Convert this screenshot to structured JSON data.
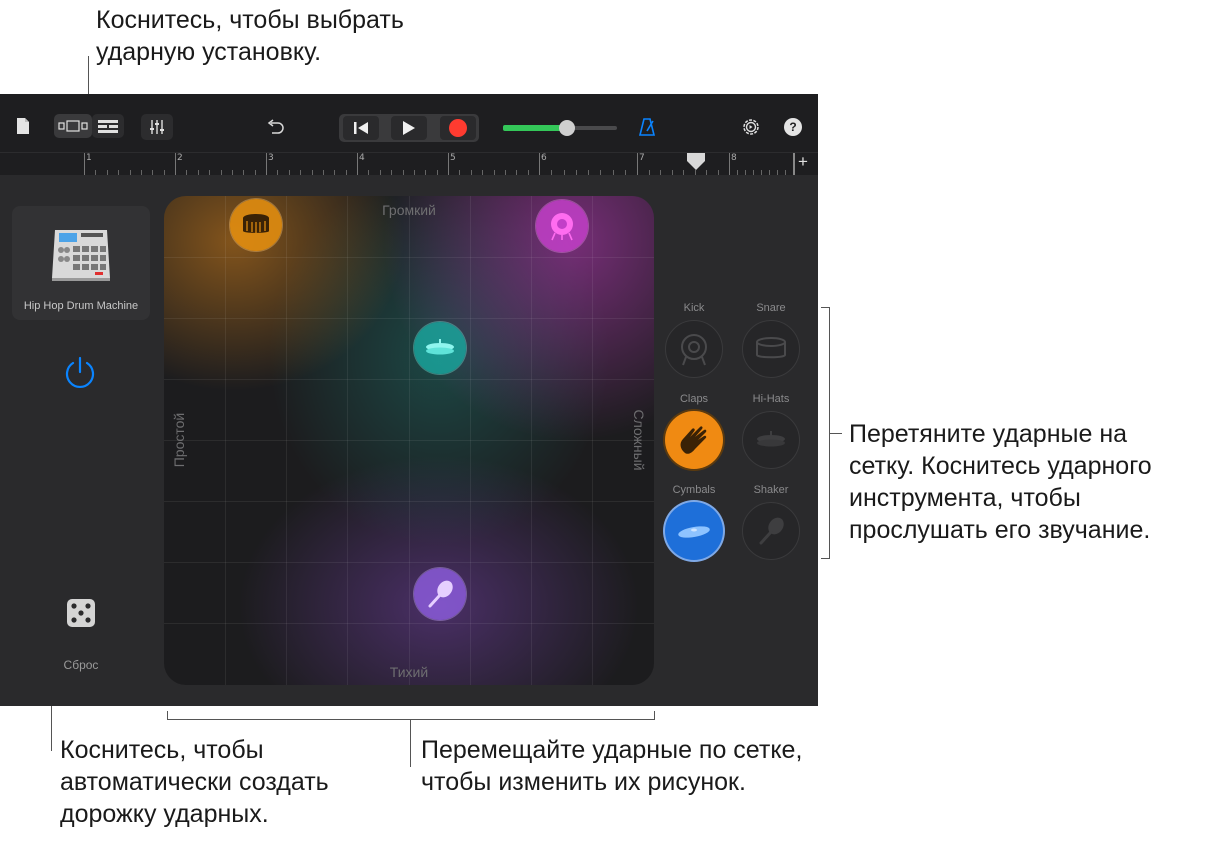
{
  "callouts": {
    "top_line1": "Коснитесь, чтобы выбрать",
    "top_line2": "ударную установку.",
    "right_line1": "Перетяните ударные на",
    "right_line2": "сетку. Коснитесь ударного",
    "right_line3": "инструмента, чтобы",
    "right_line4": "прослушать его звучание.",
    "bl_line1": "Коснитесь, чтобы",
    "bl_line2": "автоматически создать",
    "bl_line3": "дорожку ударных.",
    "bm_line1": "Перемещайте ударные по сетке,",
    "bm_line2": "чтобы изменить их рисунок."
  },
  "toolbar": {
    "icons": [
      "document-icon",
      "view-toggle-icon",
      "tracks-view-icon",
      "mixer-icon",
      "undo-icon",
      "go-to-start-icon",
      "play-icon",
      "record-icon",
      "volume-slider",
      "metronome-icon",
      "settings-icon",
      "help-icon"
    ],
    "help_label": "?",
    "volume_level": 0.8,
    "colors": {
      "record": "#ff3b30",
      "volume": "#34c759",
      "metronome": "#0a84ff"
    }
  },
  "ruler": {
    "bars": [
      "1",
      "2",
      "3",
      "4",
      "5",
      "6",
      "7",
      "8"
    ],
    "add_label": "+"
  },
  "left_panel": {
    "kit_name": "Hip Hop Drum Machine",
    "kit_icon": "drum-machine-icon",
    "power_icon": "power-icon",
    "dice_icon": "dice-icon",
    "reset_label": "Сброс",
    "power_color": "#0a84ff"
  },
  "grid": {
    "loud_label": "Громкий",
    "quiet_label": "Тихий",
    "simple_label": "Простой",
    "complex_label": "Сложный",
    "drums": [
      {
        "name": "Snare",
        "icon": "snare-icon",
        "color": "#e8900f"
      },
      {
        "name": "Kick",
        "icon": "kick-icon",
        "color": "#c23fc8"
      },
      {
        "name": "Hi-Hats",
        "icon": "hihat-icon",
        "color": "#19a9a0"
      },
      {
        "name": "Shaker",
        "icon": "shaker-icon",
        "color": "#8a5ad8"
      }
    ]
  },
  "pads": [
    {
      "label": "Kick",
      "icon": "kick-icon",
      "active": false
    },
    {
      "label": "Snare",
      "icon": "snare-icon",
      "active": false
    },
    {
      "label": "Claps",
      "icon": "claps-icon",
      "active": true,
      "color": "#f08a12"
    },
    {
      "label": "Hi-Hats",
      "icon": "hihat-icon",
      "active": false
    },
    {
      "label": "Cymbals",
      "icon": "cymbal-icon",
      "active": true,
      "color": "#1e6fd9"
    },
    {
      "label": "Shaker",
      "icon": "shaker-icon",
      "active": false
    }
  ]
}
